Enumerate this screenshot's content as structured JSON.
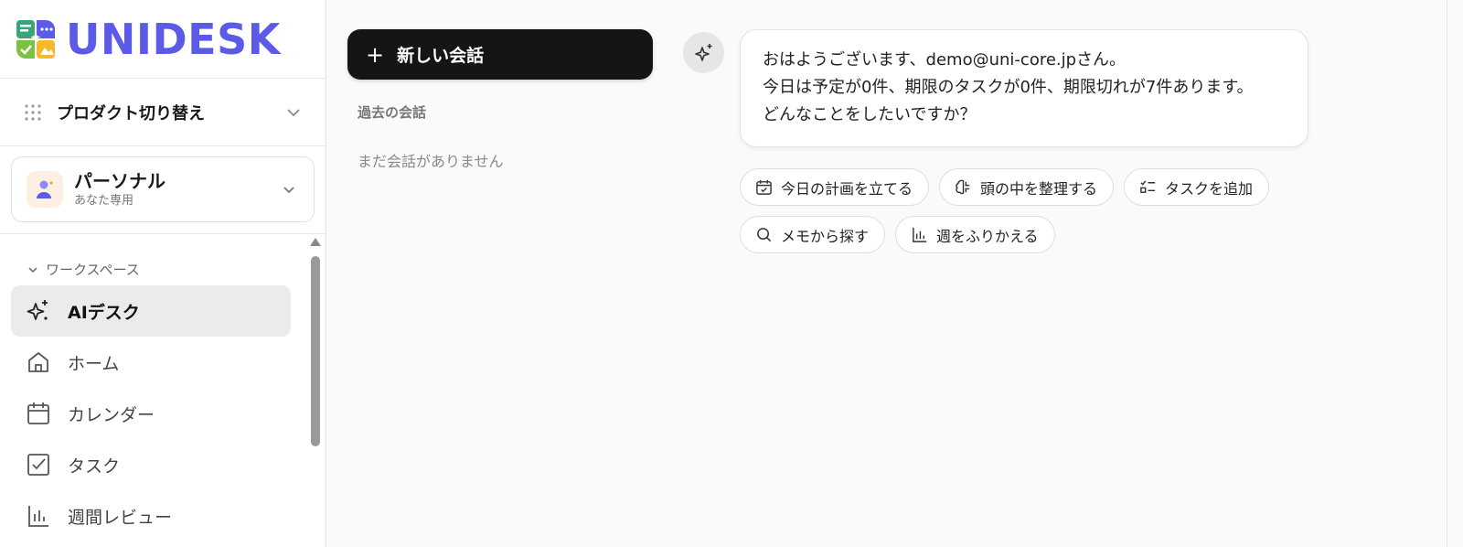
{
  "brand": {
    "name": "UNIDESK",
    "color": "#5b5be8"
  },
  "sidebar": {
    "product_switch_label": "プロダクト切り替え",
    "personal": {
      "name": "パーソナル",
      "subtitle": "あなた専用"
    },
    "workspace_header": "ワークスペース",
    "items": [
      {
        "label": "AIデスク",
        "icon": "sparkles-icon",
        "active": true
      },
      {
        "label": "ホーム",
        "icon": "home-icon"
      },
      {
        "label": "カレンダー",
        "icon": "calendar-icon"
      },
      {
        "label": "タスク",
        "icon": "checkbox-icon"
      },
      {
        "label": "週間レビュー",
        "icon": "bar-chart-icon"
      }
    ]
  },
  "conversations": {
    "new_button_label": "新しい会話",
    "past_header": "過去の会話",
    "empty_text": "まだ会話がありません"
  },
  "chat": {
    "greeting_lines": [
      "おはようございます、demo@uni-core.jpさん。",
      "今日は予定が0件、期限のタスクが0件、期限切れが7件あります。",
      "どんなことをしたいですか？"
    ],
    "suggestions": [
      {
        "label": "今日の計画を立てる",
        "icon": "calendar-check-icon"
      },
      {
        "label": "頭の中を整理する",
        "icon": "brain-icon"
      },
      {
        "label": "タスクを追加",
        "icon": "list-check-icon"
      },
      {
        "label": "メモから探す",
        "icon": "search-icon"
      },
      {
        "label": "週をふりかえる",
        "icon": "bar-chart-icon"
      }
    ]
  }
}
